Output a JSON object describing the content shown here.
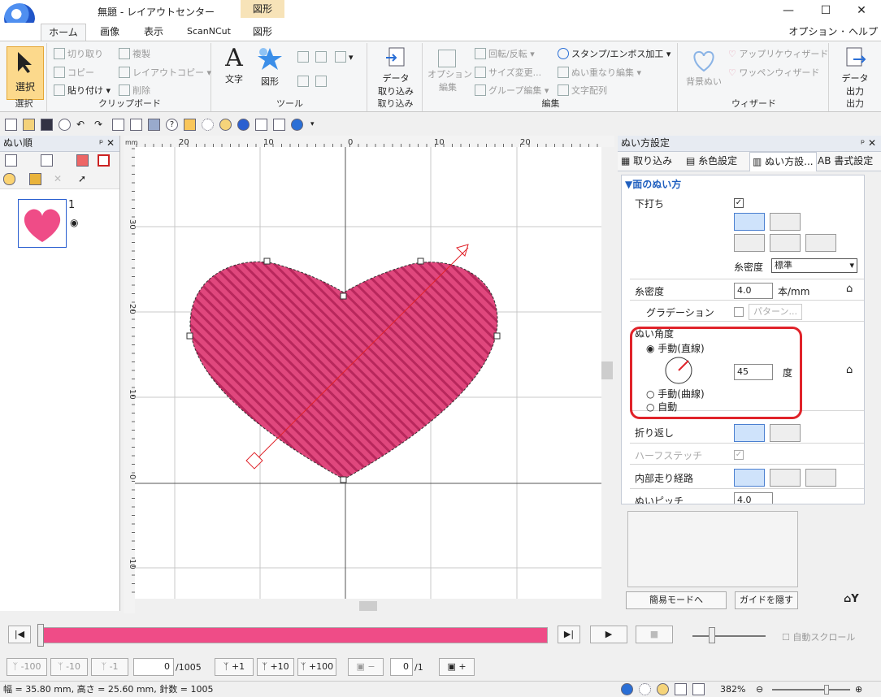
{
  "window": {
    "title": "無題 - レイアウトセンター",
    "context_tab": "図形",
    "minimize": "—",
    "maximize": "☐",
    "close": "✕"
  },
  "tabs": [
    "ホーム",
    "画像",
    "表示",
    "ScanNCut",
    "図形"
  ],
  "options_menu": "オプション ･ ヘルプ ･",
  "ribbon": {
    "select": {
      "label": "選択",
      "group": "選択"
    },
    "clipboard": {
      "cut": "切り取り",
      "copy": "コピー",
      "paste": "貼り付け",
      "duplicate": "複製",
      "layout_copy": "レイアウトコピー",
      "delete": "削除",
      "group": "クリップボード"
    },
    "tools": {
      "text": "文字",
      "shape": "図形",
      "group": "ツール"
    },
    "import": {
      "label1": "データ",
      "label2": "取り込み",
      "group": "取り込み"
    },
    "edit": {
      "option1": "オプション",
      "option2": "編集",
      "rotate": "回転/反転",
      "size": "サイズ変更...",
      "group_edit": "グループ編集",
      "stamp": "スタンプ/エンボス加工",
      "overlap": "ぬい重なり編集",
      "text_arrange": "文字配列",
      "group": "編集"
    },
    "wizard": {
      "bg": "背景ぬい",
      "applique": "アップリケウィザード",
      "wappen": "ワッペンウィザード",
      "group": "ウィザード"
    },
    "output": {
      "label1": "データ",
      "label2": "出力",
      "group": "出力"
    }
  },
  "left_panel": {
    "title": "ぬい順",
    "item_number": "1"
  },
  "ruler": {
    "top": [
      "20",
      "10",
      "0",
      "10",
      "20"
    ],
    "left": [
      "30",
      "20",
      "10",
      "0",
      "10"
    ]
  },
  "right_panel": {
    "title": "ぬい方設定",
    "tabs": [
      "取り込み",
      "糸色設定",
      "ぬい方設...",
      "書式設定"
    ],
    "section": "▼面のぬい方",
    "underlay": "下打ち",
    "density_label_small": "糸密度",
    "density_select": "標準",
    "density": "糸密度",
    "density_value": "4.0",
    "density_unit": "本/mm",
    "gradation": "グラデーション",
    "pattern_btn": "パターン...",
    "angle": "ぬい角度",
    "manual_line": "手動(直線)",
    "angle_value": "45",
    "angle_unit": "度",
    "manual_curve": "手動(曲線)",
    "auto": "自動",
    "fold": "折り返し",
    "half_stitch": "ハーフステッチ",
    "inner_path": "内部走り経路",
    "pitch": "ぬいピッチ",
    "pitch_value": "4.0",
    "simple_mode": "簡易モードへ",
    "hide_guide": "ガイドを隠す"
  },
  "playback": {
    "autoscroll": "自動スクロール",
    "progress": 1.0
  },
  "stitch": {
    "m100": "-100",
    "m10": "-10",
    "m1": "-1",
    "current": "0",
    "total": "/1005",
    "p1": "+1",
    "p10": "+10",
    "p100": "+100",
    "color_current": "0",
    "color_total": "/1"
  },
  "status": {
    "dims": "幅 = 35.80 mm, 高さ = 25.60 mm, 針数 = 1005",
    "zoom": "382%"
  },
  "colors": {
    "heart": "#e0477d",
    "highlight": "#e0232a",
    "progress": "#ef4c87"
  }
}
